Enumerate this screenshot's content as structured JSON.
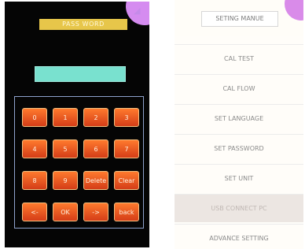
{
  "left_panel": {
    "title": "PASS WORD",
    "password_value": "",
    "keypad": [
      [
        "0",
        "1",
        "2",
        "3"
      ],
      [
        "4",
        "5",
        "6",
        "7"
      ],
      [
        "8",
        "9",
        "Delete",
        "Clear"
      ],
      [
        "<-",
        "OK",
        "->",
        "back"
      ]
    ]
  },
  "right_panel": {
    "title": "SETING MANUE",
    "menu": [
      {
        "label": "CAL TEST"
      },
      {
        "label": "CAL FLOW"
      },
      {
        "label": "SET LANGUAGE"
      },
      {
        "label": "SET PASSWORD"
      },
      {
        "label": "SET UNIT"
      },
      {
        "label": "USB CONNECT PC",
        "highlighted": true
      },
      {
        "label": "ADVANCE SETTING"
      }
    ]
  }
}
